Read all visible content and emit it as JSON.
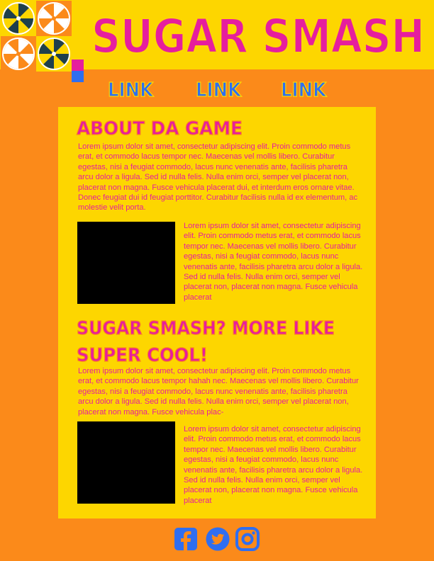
{
  "site": {
    "title": "SUGAR SMASH"
  },
  "nav": {
    "links": [
      {
        "label": "LINK"
      },
      {
        "label": "LINK"
      },
      {
        "label": "LINK"
      }
    ]
  },
  "sections": [
    {
      "heading_lines": [
        "ABOUT DA GAME"
      ],
      "intro": "Lorem ipsum dolor sit amet, consectetur adipiscing elit. Proin commodo metus erat, et commodo lacus tempor nec. Maecenas vel mollis libero. Curabitur egestas, nisi a feugiat commodo, lacus nunc venenatis ante, facilisis pharetra arcu dolor a ligula. Sed id nulla felis. Nulla enim orci, semper vel placerat non, placerat non magna. Fusce vehicula placerat dui, et interdum eros ornare vitae. Donec feugiat dui id feugiat porttitor. Curabitur facilisis nulla id ex elementum, ac molestie velit porta.",
      "side_text": "Lorem ipsum dolor sit amet, consectetur adipiscing elit. Proin commodo metus erat, et commodo lacus tempor nec. Maecenas vel mollis libero. Curabitur egestas, nisi a feugiat commodo, lacus nunc venenatis ante, facilisis pharetra arcu dolor a ligula. Sed id nulla felis. Nulla enim orci, semper vel placerat non, placerat non magna. Fusce vehicula placerat"
    },
    {
      "heading_lines": [
        "SUGAR SMASH? MORE LIKE",
        "SUPER COOL!"
      ],
      "intro": "Lorem ipsum dolor sit amet, consectetur adipiscing elit. Proin commodo metus erat, et commodo lacus tempor hahah nec. Maecenas vel mollis libero. Curabitur egestas, nisi a feugiat commodo, lacus nunc venenatis ante, facilisis pharetra arcu dolor a ligula. Sed id nulla felis. Nulla enim orci, semper vel placerat non, placerat non magna. Fusce vehicula plac-",
      "side_text": "Lorem ipsum dolor sit amet, consectetur adipiscing elit. Proin commodo metus erat, et commodo lacus tempor nec. Maecenas vel mollis libero. Curabitur egestas, nisi a feugiat commodo, lacus nunc venenatis ante, facilisis pharetra arcu dolor a ligula. Sed id nulla felis. Nulla enim orci, semper vel placerat non, placerat non magna. Fusce vehicula placerat"
    }
  ],
  "social": [
    {
      "icon": "facebook-icon"
    },
    {
      "icon": "twitter-icon"
    },
    {
      "icon": "instagram-icon"
    }
  ],
  "colors": {
    "background": "#FB8A1A",
    "panel": "#FDD600",
    "accent_pink": "#E61E9E",
    "accent_blue": "#2F6EF0",
    "candy_dark": "#1E3F4C"
  }
}
